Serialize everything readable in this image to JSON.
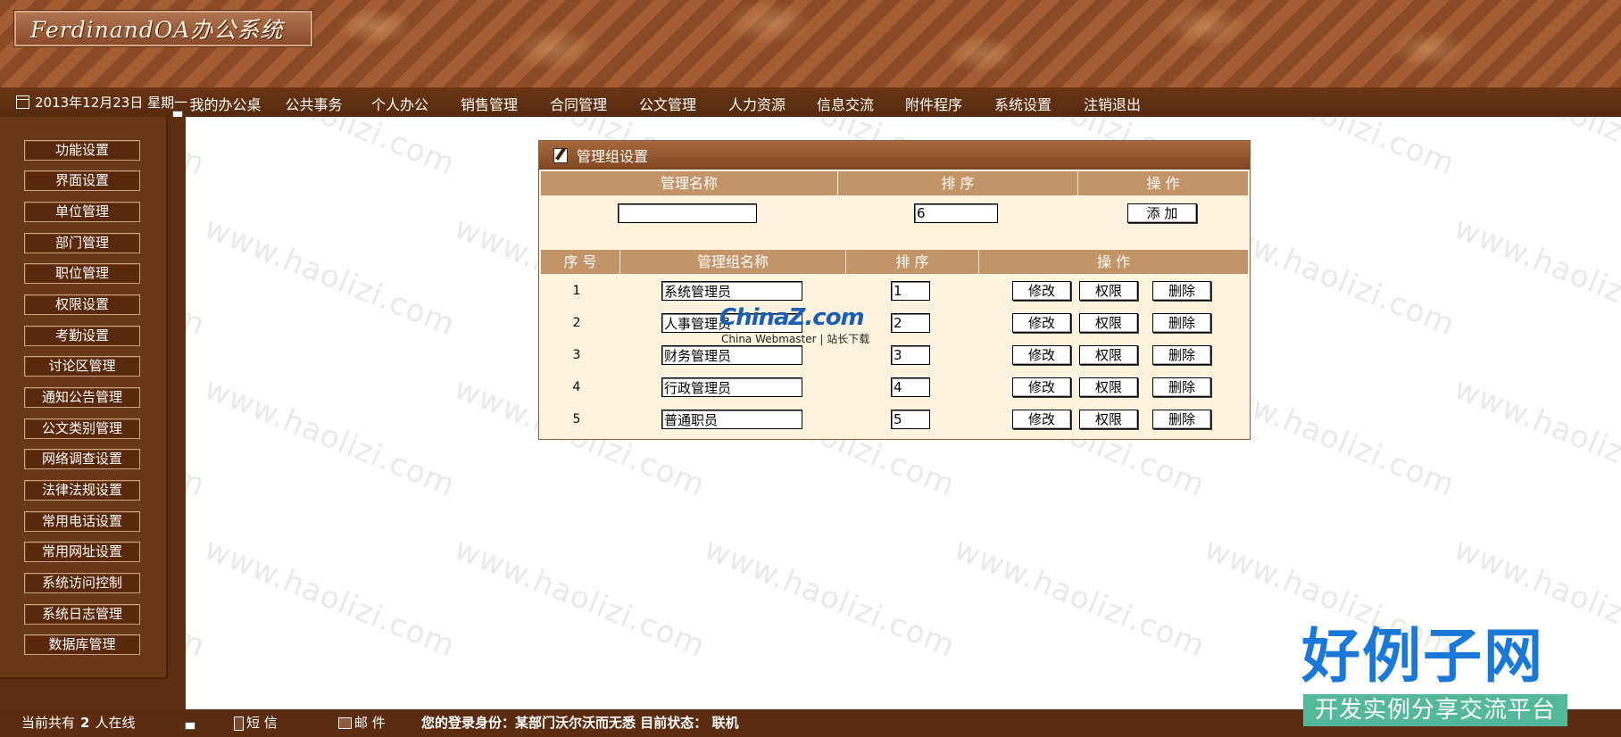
{
  "app": {
    "title": "FerdinandOA办公系统"
  },
  "nav": {
    "date": "2013年12月23日 星期一",
    "items": [
      "我的办公桌",
      "公共事务",
      "个人办公",
      "销售管理",
      "合同管理",
      "公文管理",
      "人力资源",
      "信息交流",
      "附件程序",
      "系统设置",
      "注销退出"
    ]
  },
  "sidebar": {
    "items": [
      "功能设置",
      "界面设置",
      "单位管理",
      "部门管理",
      "职位管理",
      "权限设置",
      "考勤设置",
      "讨论区管理",
      "通知公告管理",
      "公文类别管理",
      "网络调查设置",
      "法律法规设置",
      "常用电话设置",
      "常用网址设置",
      "系统访问控制",
      "系统日志管理",
      "数据库管理"
    ]
  },
  "panel": {
    "title": "管理组设置",
    "add_header": {
      "name": "管理名称",
      "order": "排 序",
      "action": "操 作"
    },
    "add_form": {
      "name_value": "",
      "order_value": "6",
      "add_label": "添 加"
    },
    "list_header": {
      "index": "序 号",
      "name": "管理组名称",
      "order": "排 序",
      "action": "操 作"
    },
    "rows": [
      {
        "index": "1",
        "name": "系统管理员",
        "order": "1"
      },
      {
        "index": "2",
        "name": "人事管理员",
        "order": "2"
      },
      {
        "index": "3",
        "name": "财务管理员",
        "order": "3"
      },
      {
        "index": "4",
        "name": "行政管理员",
        "order": "4"
      },
      {
        "index": "5",
        "name": "普通职员",
        "order": "5"
      }
    ],
    "actions": {
      "edit": "修改",
      "permission": "权限",
      "delete": "删除"
    }
  },
  "footer": {
    "online_prefix": "当前共有",
    "online_count": "2",
    "online_suffix": "人在线",
    "sms": "短 信",
    "mail": "邮 件",
    "login_status": "您的登录身份：某部门沃尔沃而无悉   目前状态：  联机"
  },
  "watermark": {
    "text": "www.haolizi.com"
  },
  "overlay_logo": {
    "main": "ChinaZ.com",
    "sub": "China Webmaster | 站长下载"
  },
  "corner_logo": {
    "main": "好例子网",
    "sub": "开发实例分享交流平台"
  },
  "colors": {
    "banner": "#944f2a",
    "nav": "#5b2c10",
    "panel_bg": "#fff3dd",
    "header_cell": "#c39467"
  }
}
